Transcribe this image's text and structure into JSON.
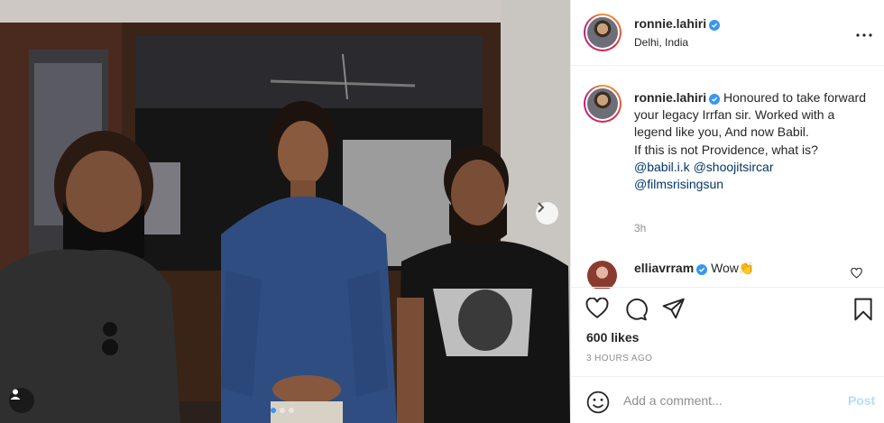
{
  "post": {
    "username": "ronnie.lahiri",
    "location": "Delhi, India",
    "caption_lines": "Honoured to take forward your legacy Irrfan sir. Worked with a legend like you, And now Babil.\nIf this is not Providence, what is?",
    "mentions": [
      "@babil.i.k",
      "@shoojitsircar",
      "@filmsrisingsun"
    ],
    "time_ago": "3h",
    "likes": "600 likes",
    "posted_time": "3 HOURS AGO"
  },
  "comment": {
    "username": "elliavrram",
    "text": "Wow",
    "emoji": "👏"
  },
  "comment_form": {
    "placeholder": "Add a comment...",
    "post_label": "Post"
  },
  "carousel": {
    "slide_count": 3,
    "active_index": 0
  },
  "colors": {
    "verified": "#3897f0",
    "link": "#00376b",
    "post_disabled": "#b2dffc",
    "muted": "#8e8e8e"
  }
}
